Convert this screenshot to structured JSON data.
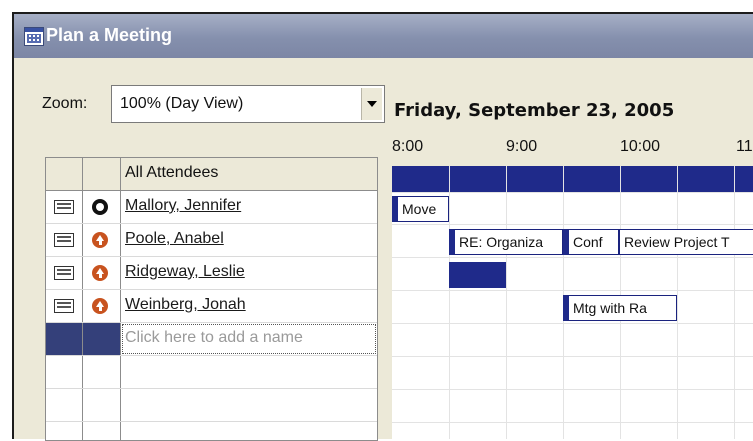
{
  "window": {
    "title": "Plan a Meeting"
  },
  "zoom": {
    "label": "Zoom:",
    "value": "100% (Day View)"
  },
  "attendees": {
    "header": "All Attendees",
    "rows": [
      {
        "name": "Mallory, Jennifer",
        "icon": "organizer-icon"
      },
      {
        "name": "Poole, Anabel",
        "icon": "required-attendee-icon"
      },
      {
        "name": "Ridgeway, Leslie",
        "icon": "required-attendee-icon"
      },
      {
        "name": "Weinberg, Jonah",
        "icon": "required-attendee-icon"
      }
    ],
    "add_placeholder": "Click here to add a name"
  },
  "schedule": {
    "date": "Friday, September 23, 2005",
    "times": [
      "8:00",
      "9:00",
      "10:00",
      "11"
    ],
    "appointments": [
      {
        "row": 0,
        "label": "Move"
      },
      {
        "row": 1,
        "label": "RE: Organiza"
      },
      {
        "row": 1,
        "label": "Conf"
      },
      {
        "row": 1,
        "label": "Review Project T"
      },
      {
        "row": 3,
        "label": "Mtg with Ra"
      }
    ]
  },
  "colors": {
    "busy": "#1f2a8a",
    "titlebar": "#8590ad"
  }
}
